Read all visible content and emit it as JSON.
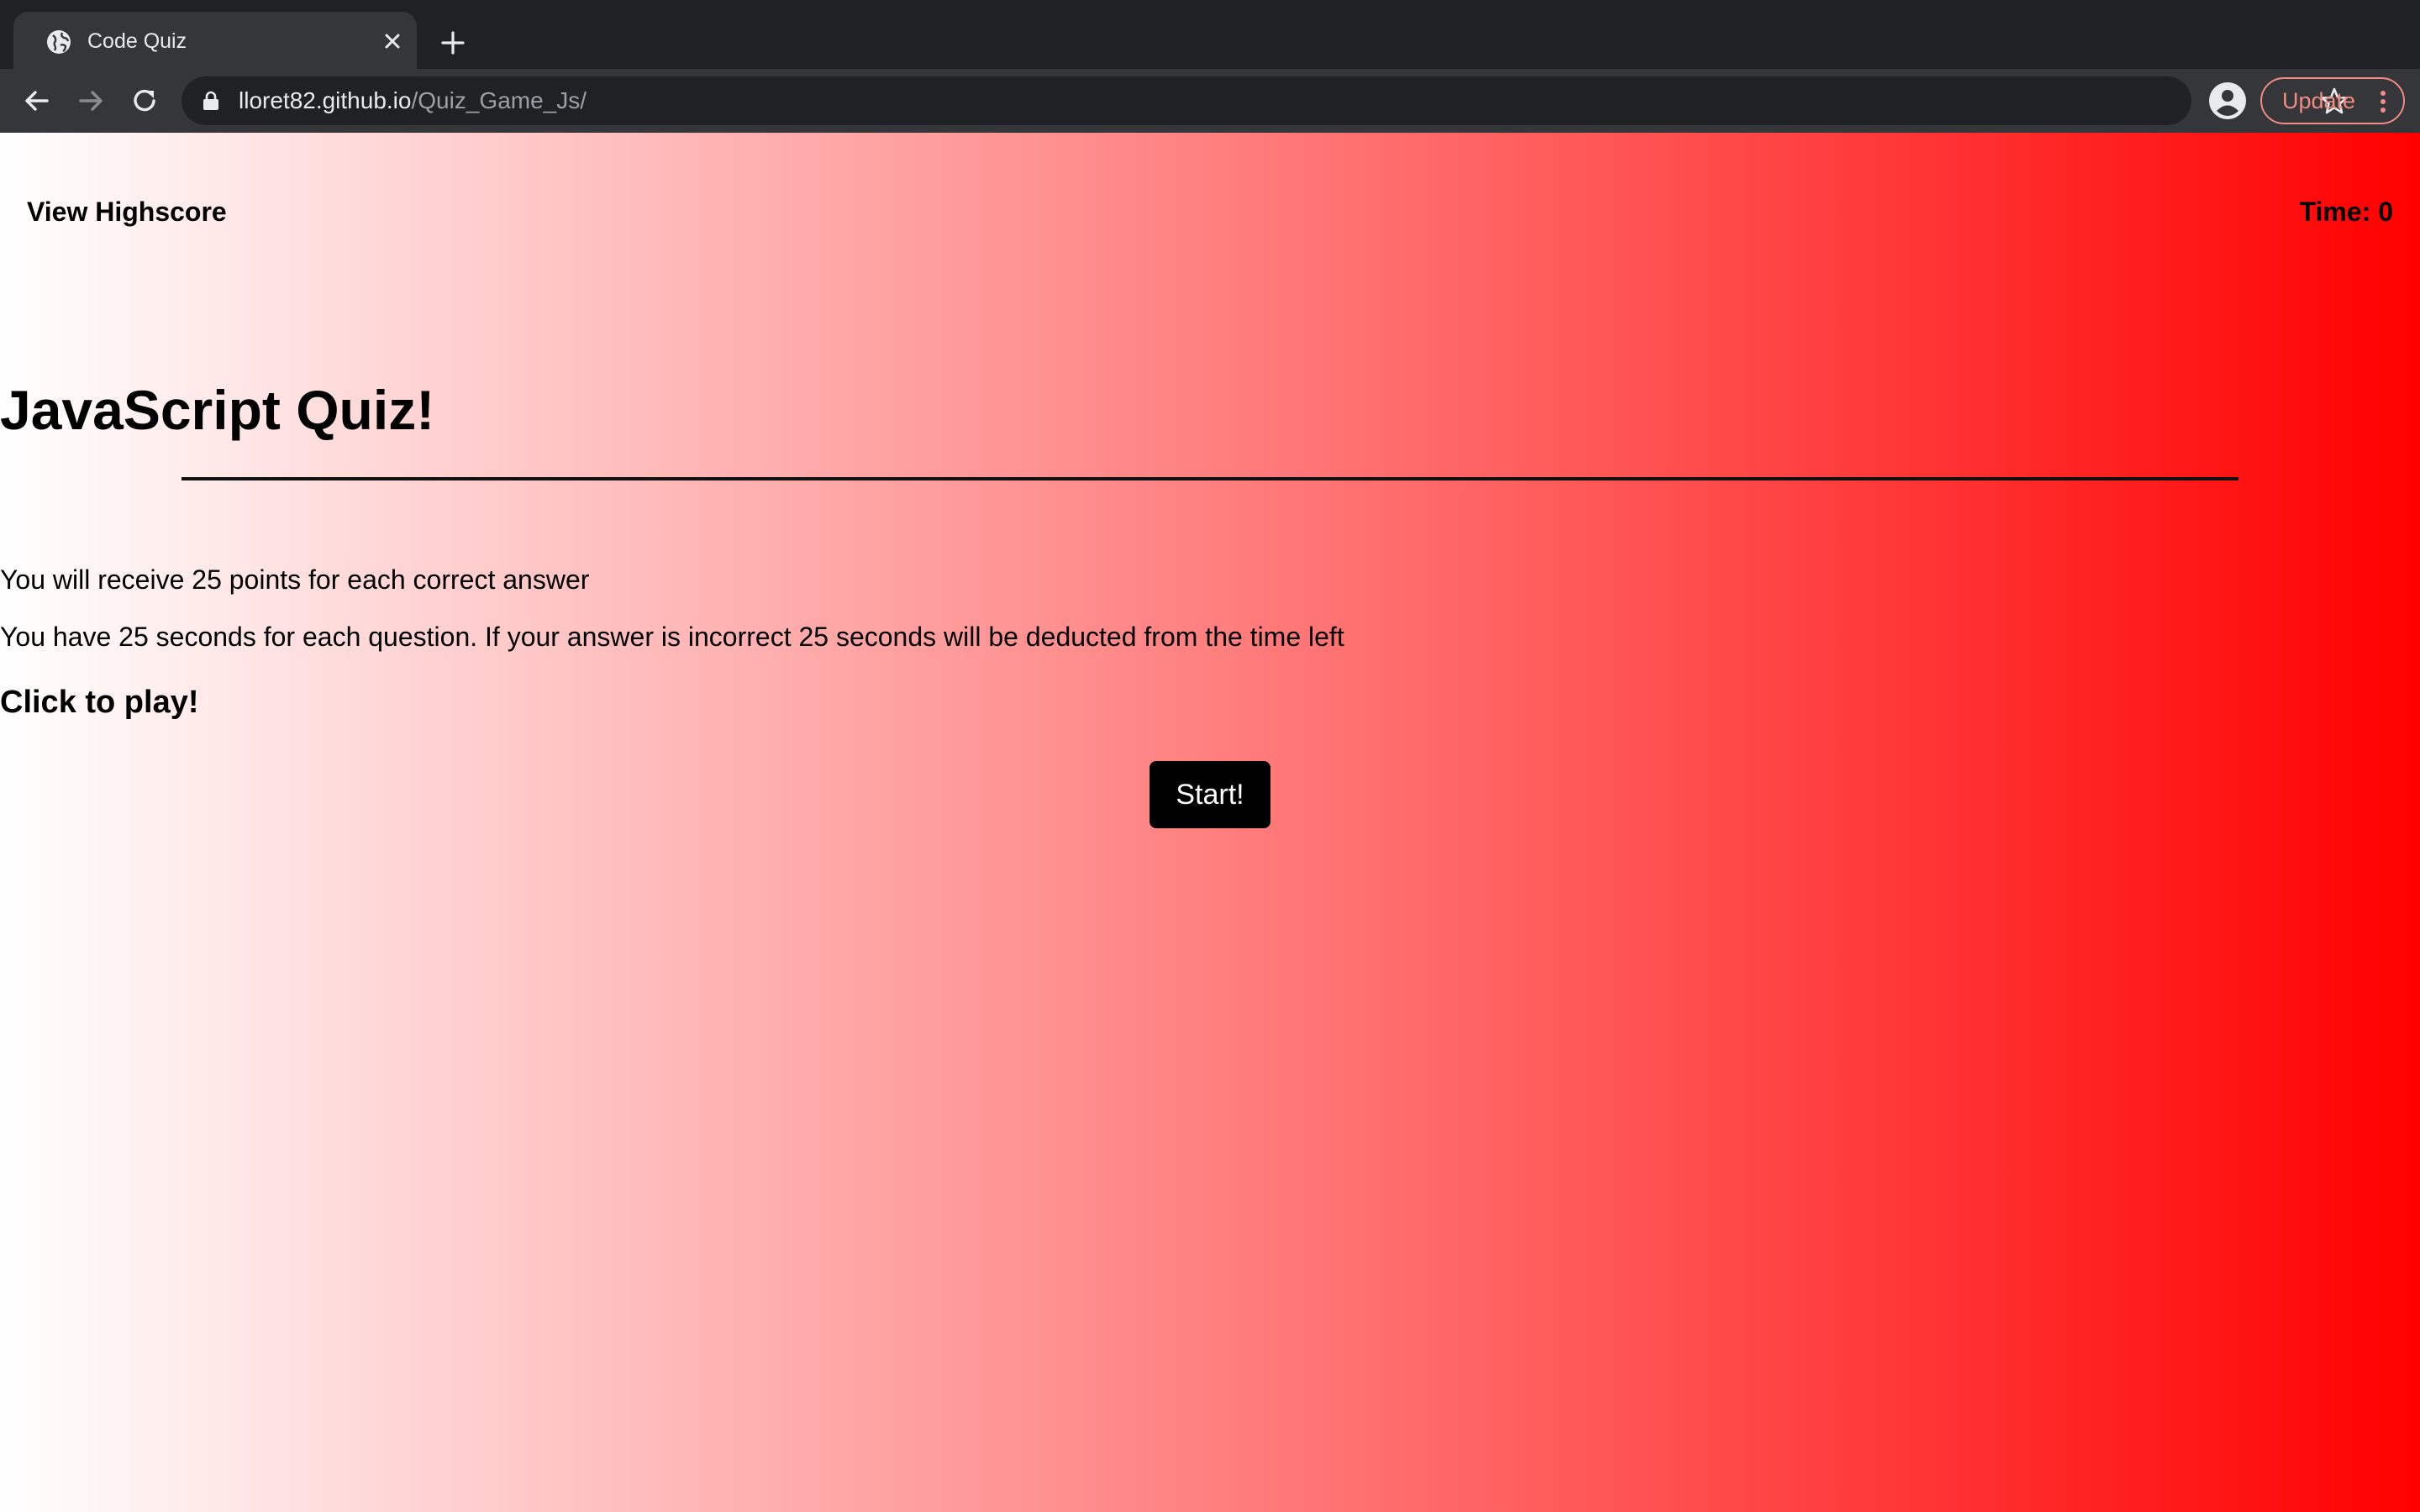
{
  "browser": {
    "tab_title": "Code Quiz",
    "url_domain": "lloret82.github.io",
    "url_path": "/Quiz_Game_Js/",
    "update_label": "Update",
    "accent_color": "#f28b82"
  },
  "page": {
    "nav_highscore": "View Highscore",
    "timer_label": "Time: ",
    "timer_value": "0",
    "title": "JavaScript Quiz!",
    "line1": "You will receive 25 points for each correct answer",
    "line2": "You have 25 seconds for each question. If your answer is incorrect 25 seconds will be deducted from the time left",
    "cta": "Click to play!",
    "start_label": "Start!",
    "gradient_from": "#ffffff",
    "gradient_to": "#ff0000"
  }
}
